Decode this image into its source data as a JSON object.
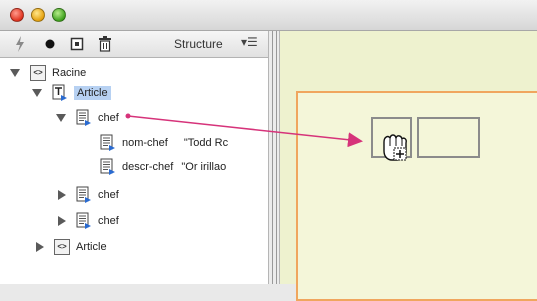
{
  "window": {
    "traffic_lights": [
      "close",
      "minimize",
      "zoom"
    ]
  },
  "structure_panel": {
    "title": "Structure",
    "toolbar_icons": [
      "lightning-icon",
      "circle-icon",
      "tag-icon",
      "trash-icon"
    ],
    "tree": [
      {
        "label": "Racine",
        "icon": "xml-element-icon",
        "expanded": true,
        "level": 0,
        "value": ""
      },
      {
        "label": "Article",
        "icon": "text-element-icon",
        "expanded": true,
        "level": 1,
        "selected": true,
        "value": ""
      },
      {
        "label": "chef",
        "icon": "doc-element-icon",
        "expanded": true,
        "level": 2,
        "value": ""
      },
      {
        "label": "nom-chef",
        "icon": "doc-element-icon",
        "level": 3,
        "value": "\"Todd Rc"
      },
      {
        "label": "descr-chef",
        "icon": "doc-element-icon",
        "level": 3,
        "value": "\"Or irillao"
      },
      {
        "label": "chef",
        "icon": "doc-element-icon",
        "expanded": false,
        "level": 2,
        "value": ""
      },
      {
        "label": "chef",
        "icon": "doc-element-icon",
        "expanded": false,
        "level": 2,
        "value": ""
      },
      {
        "label": "Article",
        "icon": "xml-element-icon",
        "expanded": false,
        "level": 1,
        "value": ""
      }
    ]
  },
  "canvas": {
    "background": "#eef2cf",
    "page_border": "#f0a65e",
    "arrow_color": "#d6337a",
    "cursor": "hand-place-icon"
  }
}
